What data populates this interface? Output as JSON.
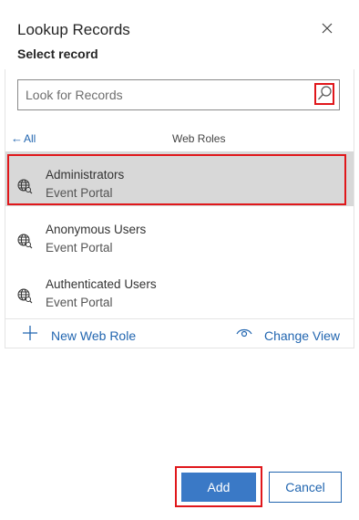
{
  "dialog": {
    "title": "Lookup Records",
    "subtitle": "Select record"
  },
  "search": {
    "placeholder": "Look for Records",
    "value": ""
  },
  "nav": {
    "back_label": "All",
    "view_name": "Web Roles"
  },
  "records": [
    {
      "name": "Administrators",
      "subtitle": "Event Portal",
      "selected": true,
      "icon": "globe-search-icon"
    },
    {
      "name": "Anonymous Users",
      "subtitle": "Event Portal",
      "selected": false,
      "icon": "globe-search-icon"
    },
    {
      "name": "Authenticated Users",
      "subtitle": "Event Portal",
      "selected": false,
      "icon": "globe-search-icon"
    }
  ],
  "actions": {
    "new_label": "New Web Role",
    "change_view_label": "Change View"
  },
  "footer": {
    "add_label": "Add",
    "cancel_label": "Cancel"
  },
  "colors": {
    "accent": "#2266b0",
    "primary_button": "#3a79c6",
    "selected_row": "#d8d8d8",
    "highlight": "#e0171b"
  }
}
